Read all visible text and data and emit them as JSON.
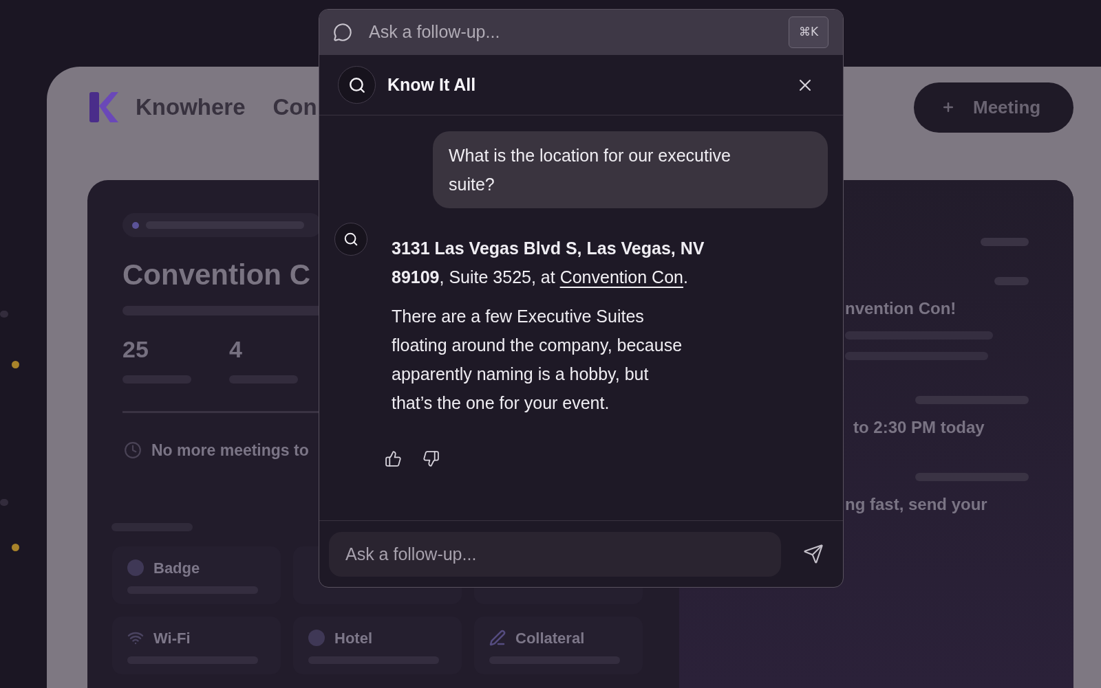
{
  "background": {
    "header": {
      "brand": "Knowhere",
      "nav_items": [
        "Con"
      ],
      "new_button": "Meeting"
    },
    "event_card": {
      "title": "Convention C",
      "stats": [
        "25",
        "4"
      ],
      "notice": "No more meetings to",
      "resource_rows": [
        [
          "Badge"
        ],
        [
          "Wi-Fi",
          "Hotel",
          "Collateral"
        ]
      ]
    },
    "activity": [
      "nvention Con!",
      "to 2:30 PM today",
      "ng fast, send your"
    ]
  },
  "command_bar": {
    "placeholder": "Ask a follow-up...",
    "shortcut": "⌘K"
  },
  "assistant_panel": {
    "title": "Know It All",
    "messages": [
      {
        "kind": "user",
        "paragraphs": [
          [
            {
              "kind": "text",
              "text": "What is the location for our executive suite?"
            }
          ]
        ]
      },
      {
        "kind": "assistant",
        "paragraphs": [
          [
            {
              "kind": "text",
              "text": "**3131 Las Vegas Blvd S, Las Vegas, NV 89109**, Suite 3525, at "
            },
            {
              "kind": "link",
              "text": "Convention Con"
            },
            {
              "kind": "text",
              "text": "."
            }
          ],
          [
            {
              "kind": "text",
              "text": "There are a few Executive Suites floating around the company, because apparently naming is a hobby, but that’s the one for your event."
            }
          ]
        ]
      }
    ],
    "reply_field": {
      "placeholder": "Ask a follow-up..."
    }
  }
}
